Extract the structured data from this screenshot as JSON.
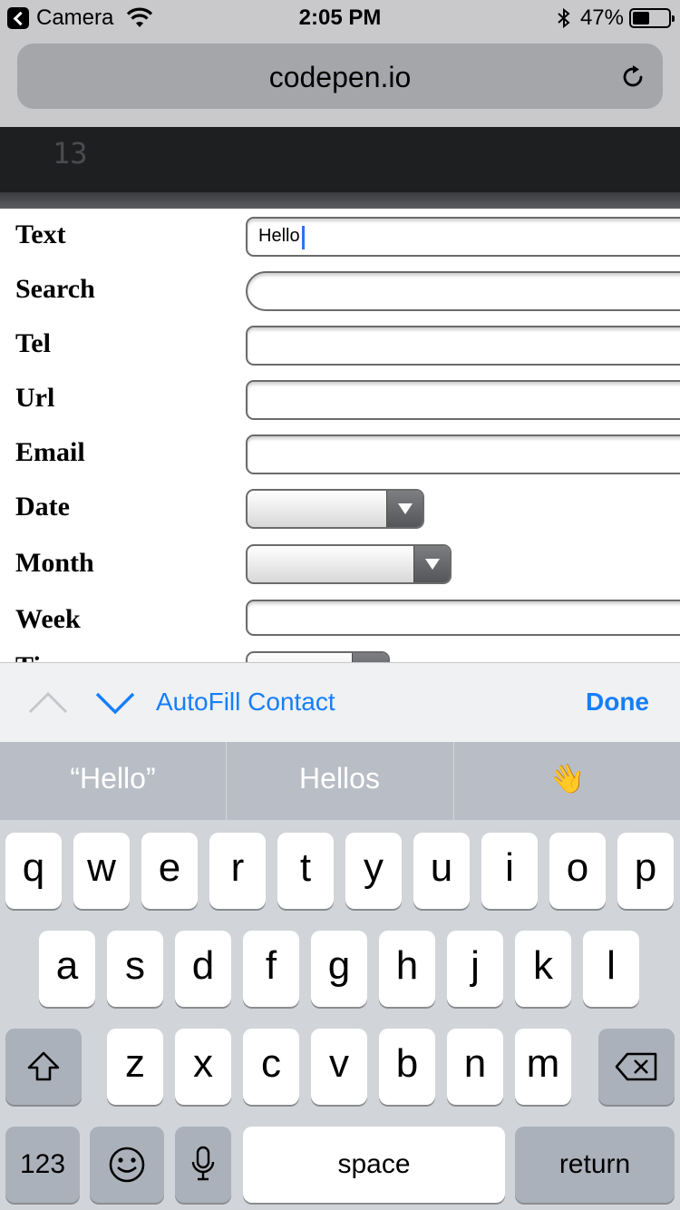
{
  "status_bar": {
    "back_app": "Camera",
    "time": "2:05 PM",
    "battery": "47%",
    "battery_level": 0.47
  },
  "browser": {
    "url": "codepen.io"
  },
  "code_strip": {
    "line_number": "13"
  },
  "form": {
    "rows": [
      {
        "label": "Text",
        "type": "text",
        "value": "Hello"
      },
      {
        "label": "Search",
        "type": "search",
        "value": ""
      },
      {
        "label": "Tel",
        "type": "text",
        "value": ""
      },
      {
        "label": "Url",
        "type": "text",
        "value": ""
      },
      {
        "label": "Email",
        "type": "text",
        "value": ""
      },
      {
        "label": "Date",
        "type": "select",
        "value": ""
      },
      {
        "label": "Month",
        "type": "select",
        "value": ""
      },
      {
        "label": "Week",
        "type": "text",
        "value": ""
      },
      {
        "label": "Ti",
        "type": "select",
        "value": ""
      }
    ]
  },
  "accessory": {
    "autofill": "AutoFill Contact",
    "done": "Done"
  },
  "suggestions": [
    "“Hello”",
    "Hellos",
    "👋"
  ],
  "keyboard": {
    "row1": [
      "q",
      "w",
      "e",
      "r",
      "t",
      "y",
      "u",
      "i",
      "o",
      "p"
    ],
    "row2": [
      "a",
      "s",
      "d",
      "f",
      "g",
      "h",
      "j",
      "k",
      "l"
    ],
    "row3": [
      "z",
      "x",
      "c",
      "v",
      "b",
      "n",
      "m"
    ],
    "numbers": "123",
    "space": "space",
    "return": "return"
  },
  "colors": {
    "accent": "#157efb",
    "caret": "#2f6ff5"
  }
}
